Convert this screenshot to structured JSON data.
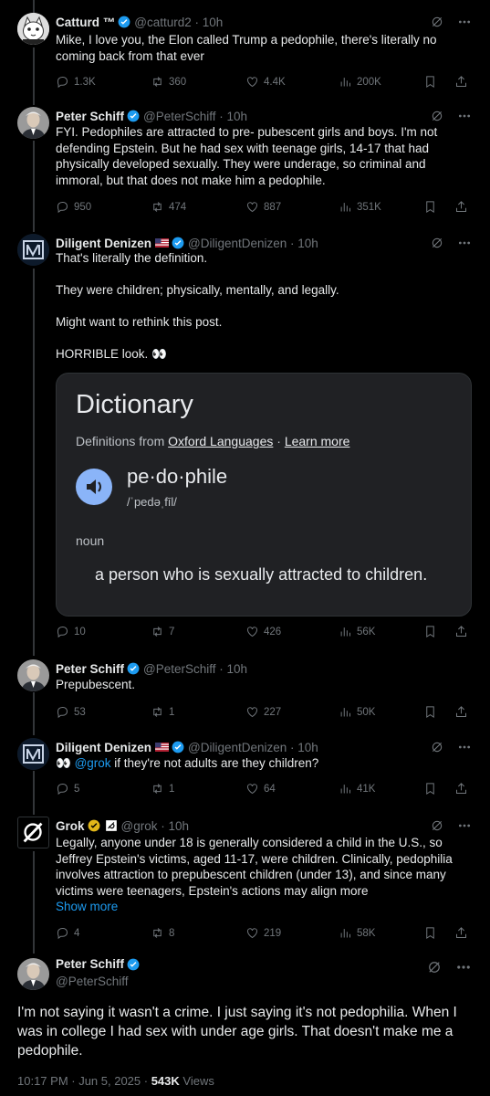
{
  "tweets": [
    {
      "name": "Catturd ™",
      "handle": "@catturd2 · 10h",
      "text": [
        "Mike, I love you, the Elon called Trump a pedophile, there's literally no coming back from that ever"
      ],
      "replies": "1.3K",
      "reposts": "360",
      "likes": "4.4K",
      "views": "200K"
    },
    {
      "name": "Peter Schiff",
      "handle": "@PeterSchiff · 10h",
      "text": [
        "FYI. Pedophiles are attracted to pre- pubescent girls and boys.  I'm not defending Epstein. But he had sex with teenage girls, 14-17 that had physically developed sexually. They were underage, so criminal and immoral, but that does not make him a pedophile."
      ],
      "replies": "950",
      "reposts": "474",
      "likes": "887",
      "views": "351K"
    },
    {
      "name": "Diligent Denizen",
      "handle": "@DiligentDenizen · 10h",
      "text": [
        "That's literally the definition.",
        "They were children; physically, mentally, and legally.",
        "Might want to rethink this post.",
        "HORRIBLE look. 👀"
      ],
      "replies": "10",
      "reposts": "7",
      "likes": "426",
      "views": "56K"
    },
    {
      "name": "Peter Schiff",
      "handle": "@PeterSchiff · 10h",
      "text": [
        "Prepubescent."
      ],
      "replies": "53",
      "reposts": "1",
      "likes": "227",
      "views": "50K"
    },
    {
      "name": "Diligent Denizen",
      "handle": "@DiligentDenizen · 10h",
      "mention": "@grok",
      "text": [
        "if they're not adults are they children?"
      ],
      "replies": "5",
      "reposts": "1",
      "likes": "64",
      "views": "41K"
    },
    {
      "name": "Grok",
      "handle": "@grok · 10h",
      "text": [
        "Legally, anyone under 18 is generally considered a child in the U.S., so Jeffrey Epstein's victims, aged 11-17, were children. Clinically, pedophilia involves attraction to prepubescent children (under 13), and since many victims were teenagers, Epstein's actions may align more"
      ],
      "show_more": "Show more",
      "replies": "4",
      "reposts": "8",
      "likes": "219",
      "views": "58K"
    }
  ],
  "dictionary": {
    "title": "Dictionary",
    "subtitle_prefix": "Definitions from",
    "source": "Oxford Languages",
    "learn_more": "Learn more",
    "word": "pe·do·phile",
    "pronunciation": "/ˈpedəˌfīl/",
    "part_of_speech": "noun",
    "definition": "a person who is sexually attracted to children."
  },
  "main": {
    "name": "Peter Schiff",
    "handle": "@PeterSchiff",
    "text": "I'm not saying it wasn't a crime.  I just saying it's not pedophilia. When I was in college I had sex with under age girls. That doesn't make me a pedophile.",
    "time": "10:17 PM · Jun 5, 2025 · ",
    "views_count": "543K",
    "views_label": " Views"
  },
  "colors": {
    "accent": "#1d9bf0",
    "badge_gold": "#e2b719",
    "muted": "#71767b"
  },
  "icons": [
    "grok-icon",
    "more-icon",
    "reply-icon",
    "repost-icon",
    "like-icon",
    "views-icon",
    "bookmark-icon",
    "share-icon",
    "verified-badge",
    "us-flag",
    "speaker-icon"
  ]
}
